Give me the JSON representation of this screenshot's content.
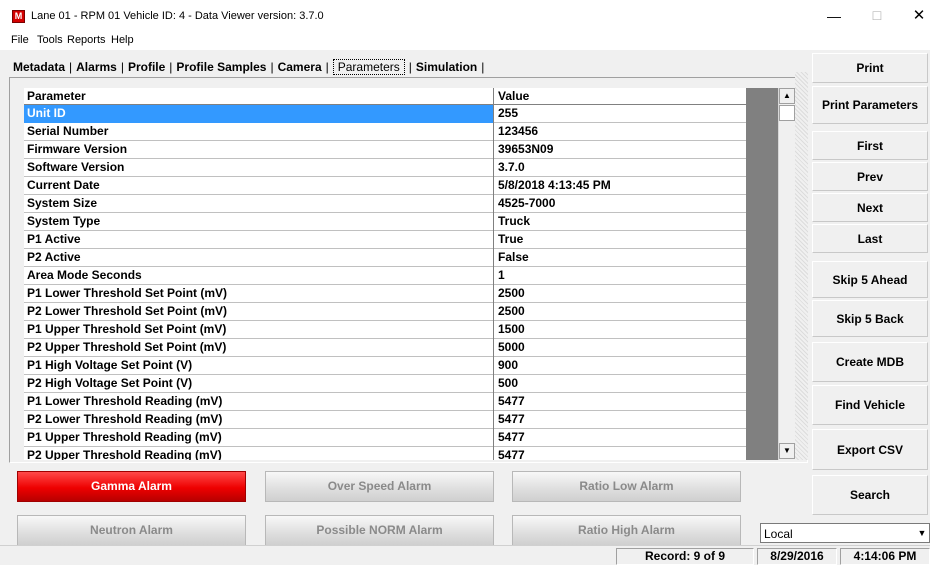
{
  "window": {
    "app_icon": "M",
    "title": "Lane 01 - RPM 01  Vehicle ID: 4 - Data Viewer    version: 3.7.0",
    "minimize": "—",
    "maximize": "☐",
    "close": "✕"
  },
  "menu": [
    "File",
    "Tools",
    "Reports",
    "Help"
  ],
  "tabs": [
    "Metadata",
    "Alarms",
    "Profile",
    "Profile Samples",
    "Camera",
    "Parameters",
    "Simulation"
  ],
  "active_tab": "Parameters",
  "grid": {
    "headers": [
      "Parameter",
      "Value"
    ],
    "rows": [
      [
        "Unit ID",
        "255"
      ],
      [
        "Serial Number",
        "123456"
      ],
      [
        "Firmware Version",
        "39653N09"
      ],
      [
        "Software Version",
        "3.7.0"
      ],
      [
        "Current Date",
        "5/8/2018 4:13:45 PM"
      ],
      [
        "System Size",
        "4525-7000"
      ],
      [
        "System Type",
        "Truck"
      ],
      [
        "P1 Active",
        "True"
      ],
      [
        "P2 Active",
        "False"
      ],
      [
        "Area Mode Seconds",
        "1"
      ],
      [
        "P1 Lower Threshold Set Point (mV)",
        "2500"
      ],
      [
        "P2 Lower Threshold Set Point (mV)",
        "2500"
      ],
      [
        "P1 Upper Threshold Set Point (mV)",
        "1500"
      ],
      [
        "P2 Upper Threshold Set Point (mV)",
        "5000"
      ],
      [
        "P1 High Voltage Set Point (V)",
        "900"
      ],
      [
        "P2 High Voltage Set Point (V)",
        "500"
      ],
      [
        "P1 Lower Threshold Reading (mV)",
        "5477"
      ],
      [
        "P2 Lower Threshold Reading (mV)",
        "5477"
      ],
      [
        "P1 Upper Threshold Reading (mV)",
        "5477"
      ],
      [
        "P2 Upper Threshold Reading (mV)",
        "5477"
      ]
    ],
    "selected_row": 0,
    "scroll_up": "▲",
    "scroll_down": "▼"
  },
  "side_buttons": [
    "Print",
    "Print Parameters",
    "First",
    "Prev",
    "Next",
    "Last",
    "Skip 5 Ahead",
    "Skip 5 Back",
    "Create MDB",
    "Find Vehicle",
    "Export CSV",
    "Search"
  ],
  "alarms": [
    {
      "label": "Gamma Alarm",
      "active": true
    },
    {
      "label": "Over Speed Alarm",
      "active": false
    },
    {
      "label": "Ratio Low Alarm",
      "active": false
    },
    {
      "label": "Neutron Alarm",
      "active": false
    },
    {
      "label": "Possible NORM Alarm",
      "active": false
    },
    {
      "label": "Ratio High Alarm",
      "active": false
    }
  ],
  "colors": {
    "alarm_active": "#ee0000",
    "selection": "#3399ff"
  },
  "location_select": {
    "value": "Local",
    "arrow": "▼"
  },
  "status": {
    "record": "Record: 9 of 9",
    "date": "8/29/2016",
    "time": "4:14:06 PM"
  }
}
